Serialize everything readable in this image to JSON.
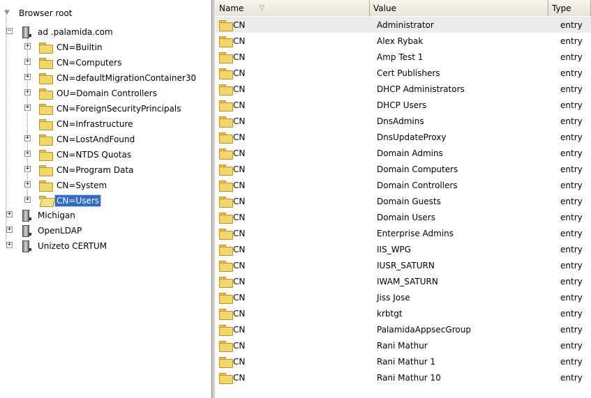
{
  "tree": {
    "root_label": "Browser root",
    "nodes": [
      {
        "label": "ad .palamida.com"
      },
      {
        "label": "CN=Builtin"
      },
      {
        "label": "CN=Computers"
      },
      {
        "label": "CN=defaultMigrationContainer30"
      },
      {
        "label": "OU=Domain Controllers"
      },
      {
        "label": "CN=ForeignSecurityPrincipals"
      },
      {
        "label": "CN=Infrastructure"
      },
      {
        "label": "CN=LostAndFound"
      },
      {
        "label": "CN=NTDS Quotas"
      },
      {
        "label": "CN=Program Data"
      },
      {
        "label": "CN=System"
      },
      {
        "label": "CN=Users",
        "selected": true
      },
      {
        "label": "Michigan"
      },
      {
        "label": "OpenLDAP"
      },
      {
        "label": "Unizeto CERTUM"
      }
    ]
  },
  "list": {
    "columns": [
      "Name",
      "Value",
      "Type"
    ],
    "sort_indicator": "▽",
    "rows": [
      {
        "name": "CN",
        "value": "Administrator",
        "type": "entry"
      },
      {
        "name": "CN",
        "value": "Alex Rybak",
        "type": "entry"
      },
      {
        "name": "CN",
        "value": "Amp Test 1",
        "type": "entry"
      },
      {
        "name": "CN",
        "value": "Cert Publishers",
        "type": "entry"
      },
      {
        "name": "CN",
        "value": "DHCP Administrators",
        "type": "entry"
      },
      {
        "name": "CN",
        "value": "DHCP Users",
        "type": "entry"
      },
      {
        "name": "CN",
        "value": "DnsAdmins",
        "type": "entry"
      },
      {
        "name": "CN",
        "value": "DnsUpdateProxy",
        "type": "entry"
      },
      {
        "name": "CN",
        "value": "Domain Admins",
        "type": "entry"
      },
      {
        "name": "CN",
        "value": "Domain Computers",
        "type": "entry"
      },
      {
        "name": "CN",
        "value": "Domain Controllers",
        "type": "entry"
      },
      {
        "name": "CN",
        "value": "Domain Guests",
        "type": "entry"
      },
      {
        "name": "CN",
        "value": "Domain Users",
        "type": "entry"
      },
      {
        "name": "CN",
        "value": "Enterprise Admins",
        "type": "entry"
      },
      {
        "name": "CN",
        "value": "IIS_WPG",
        "type": "entry"
      },
      {
        "name": "CN",
        "value": "IUSR_SATURN",
        "type": "entry"
      },
      {
        "name": "CN",
        "value": "IWAM_SATURN",
        "type": "entry"
      },
      {
        "name": "CN",
        "value": "Jiss Jose",
        "type": "entry"
      },
      {
        "name": "CN",
        "value": "krbtgt",
        "type": "entry"
      },
      {
        "name": "CN",
        "value": "PalamidaAppsecGroup",
        "type": "entry"
      },
      {
        "name": "CN",
        "value": "Rani Mathur",
        "type": "entry"
      },
      {
        "name": "CN",
        "value": "Rani Mathur 1",
        "type": "entry"
      },
      {
        "name": "CN",
        "value": "Rani Mathur 10",
        "type": "entry"
      }
    ]
  },
  "colors": {
    "selection": "#316ac5",
    "header_bg": "#ece9d8",
    "folder": "#f4d76a"
  }
}
